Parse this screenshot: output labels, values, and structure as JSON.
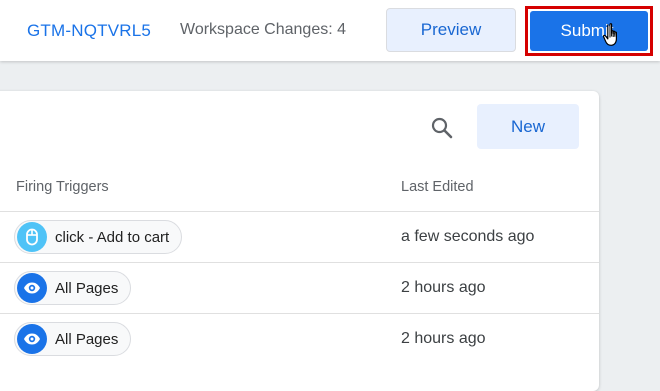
{
  "header": {
    "container_id": "GTM-NQTVRL5",
    "workspace_changes": "Workspace Changes: 4",
    "preview_label": "Preview",
    "submit_label": "Submit"
  },
  "toolbar": {
    "new_label": "New",
    "search_icon": "search-icon"
  },
  "table": {
    "columns": [
      "Firing Triggers",
      "Last Edited"
    ],
    "rows": [
      {
        "trigger": "click - Add to cart",
        "trigger_icon": "mouse-icon",
        "icon_color": "#4fc3f7",
        "last_edited": "a few seconds ago"
      },
      {
        "trigger": "All Pages",
        "trigger_icon": "eye-icon",
        "icon_color": "#1a73e8",
        "last_edited": "2 hours ago"
      },
      {
        "trigger": "All Pages",
        "trigger_icon": "eye-icon",
        "icon_color": "#1a73e8",
        "last_edited": "2 hours ago"
      }
    ]
  },
  "colors": {
    "accent": "#1a73e8",
    "highlight_border": "#d50000"
  }
}
